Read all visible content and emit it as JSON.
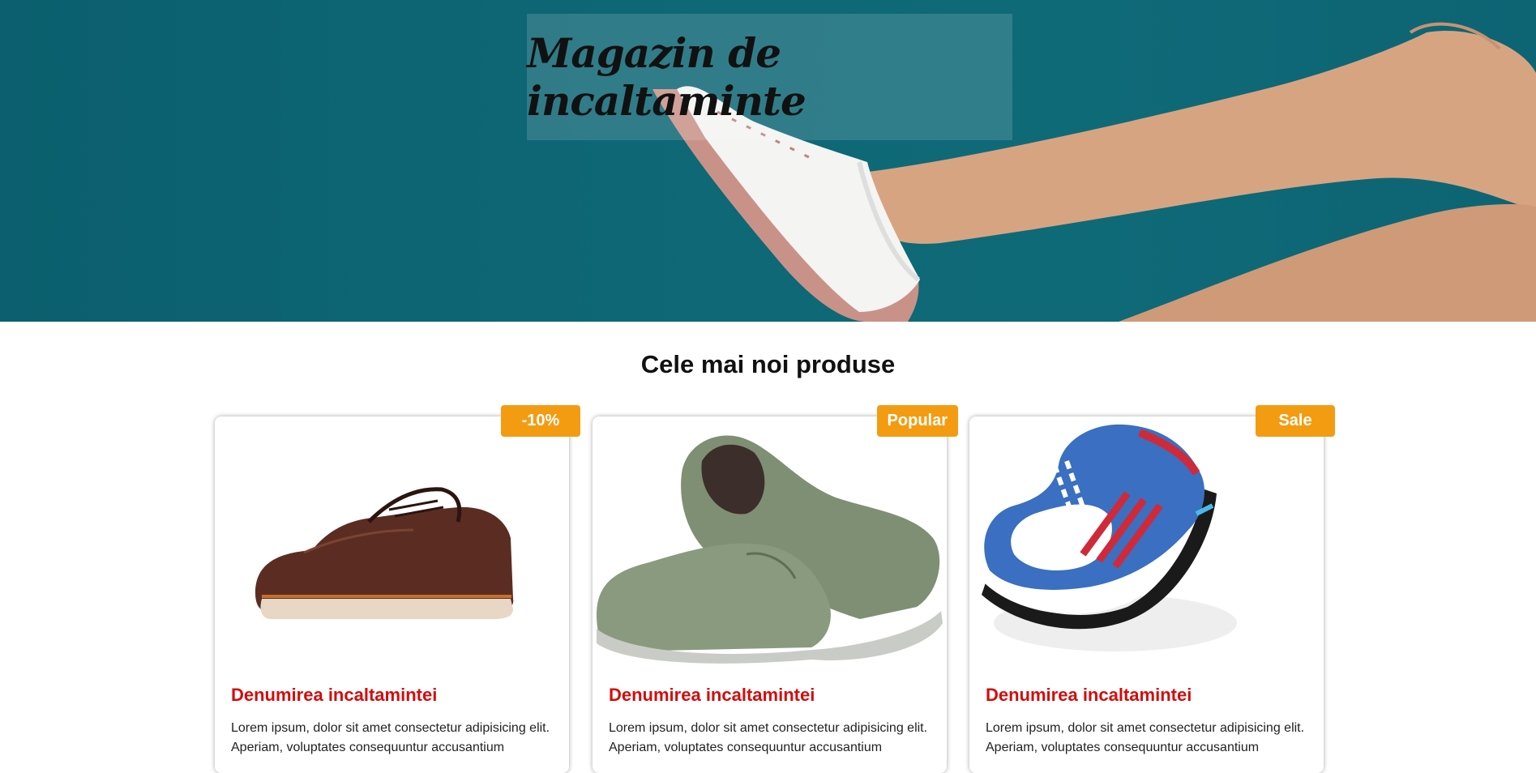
{
  "hero": {
    "title": "Magazin de incaltaminte",
    "background_color": "#0e6775"
  },
  "products_section": {
    "title": "Cele mai noi produse"
  },
  "products": [
    {
      "badge": "-10%",
      "name": "Denumirea incaltamintei",
      "description": "Lorem ipsum, dolor sit amet consectetur adipisicing elit. Aperiam, voluptates consequuntur accusantium",
      "image": "brown-leather-shoe"
    },
    {
      "badge": "Popular",
      "name": "Denumirea incaltamintei",
      "description": "Lorem ipsum, dolor sit amet consectetur adipisicing elit. Aperiam, voluptates consequuntur accusantium",
      "image": "green-canvas-loafers"
    },
    {
      "badge": "Sale",
      "name": "Denumirea incaltamintei",
      "description": "Lorem ipsum, dolor sit amet consectetur adipisicing elit. Aperiam, voluptates consequuntur accusantium",
      "image": "adidas-blue-sneaker"
    }
  ],
  "colors": {
    "badge": "#f39c12",
    "product_name": "#d50c0c"
  }
}
